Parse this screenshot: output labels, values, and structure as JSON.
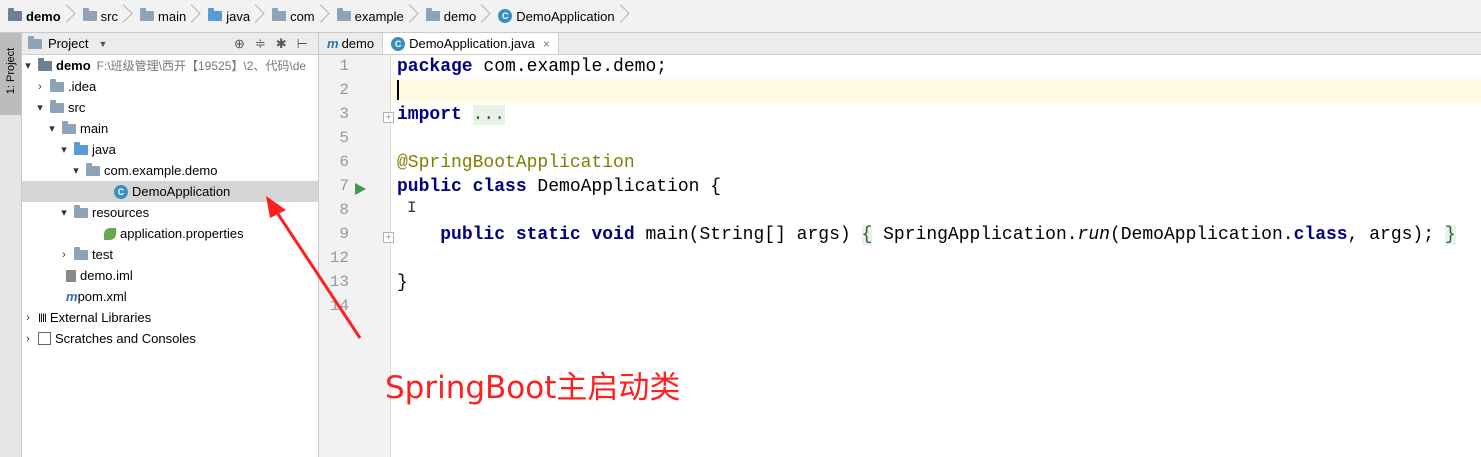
{
  "breadcrumb": [
    "demo",
    "src",
    "main",
    "java",
    "com",
    "example",
    "demo",
    "DemoApplication"
  ],
  "stripe": {
    "tab_label": "1: Project"
  },
  "project": {
    "title": "Project",
    "tools": [
      "⊕",
      "≑",
      "✱",
      "⊢"
    ],
    "tree": [
      {
        "label": "demo",
        "path": "F:\\班级管理\\西开【19525】\\2、代码\\de",
        "arrow": "▾",
        "icon": "folder",
        "bold": true
      },
      {
        "label": ".idea",
        "arrow": "›",
        "icon": "folder"
      },
      {
        "label": "src",
        "arrow": "▾",
        "icon": "folder"
      },
      {
        "label": "main",
        "arrow": "▾",
        "icon": "folder"
      },
      {
        "label": "java",
        "arrow": "▾",
        "icon": "folder-blue"
      },
      {
        "label": "com.example.demo",
        "arrow": "▾",
        "icon": "package"
      },
      {
        "label": "DemoApplication",
        "arrow": "",
        "icon": "class",
        "selected": true
      },
      {
        "label": "resources",
        "arrow": "▾",
        "icon": "folder"
      },
      {
        "label": "application.properties",
        "arrow": "",
        "icon": "spring-leaf"
      },
      {
        "label": "test",
        "arrow": "›",
        "icon": "folder"
      },
      {
        "label": "demo.iml",
        "arrow": "",
        "icon": "iml"
      },
      {
        "label": "pom.xml",
        "arrow": "",
        "icon": "maven"
      },
      {
        "label": "External Libraries",
        "arrow": "›",
        "icon": "libraries"
      },
      {
        "label": "Scratches and Consoles",
        "arrow": "›",
        "icon": "scratches"
      }
    ]
  },
  "editor": {
    "tabs": [
      {
        "label": "demo",
        "icon": "m",
        "active": false
      },
      {
        "label": "DemoApplication.java",
        "icon": "class",
        "active": true
      }
    ],
    "line_numbers": [
      "1",
      "2",
      "3",
      "5",
      "6",
      "7",
      "8",
      "9",
      "12",
      "13",
      "14"
    ],
    "code": {
      "l1_kw": "package",
      "l1_rest": " com.example.demo;",
      "l3_kw": "import",
      "l3_fold": "...",
      "l6_ann": "@SpringBootApplication",
      "l7_kw": "public class",
      "l7_rest": " DemoApplication {",
      "l9_kw1": "public static void",
      "l9_a": " main(String[] args) ",
      "l9_b": "{",
      "l9_c": " SpringApplication.",
      "l9_run": "run",
      "l9_d": "(DemoApplication.",
      "l9_kw2": "class",
      "l9_e": ", args); ",
      "l9_f": "}",
      "l13": "}"
    }
  },
  "annotation": {
    "text": "SpringBoot主启动类",
    "color": "#ff1f1f"
  },
  "colors": {
    "keyword": "#000080",
    "annotation": "#808000",
    "run": "#3f9a4c",
    "current_line": "#fffae3"
  }
}
